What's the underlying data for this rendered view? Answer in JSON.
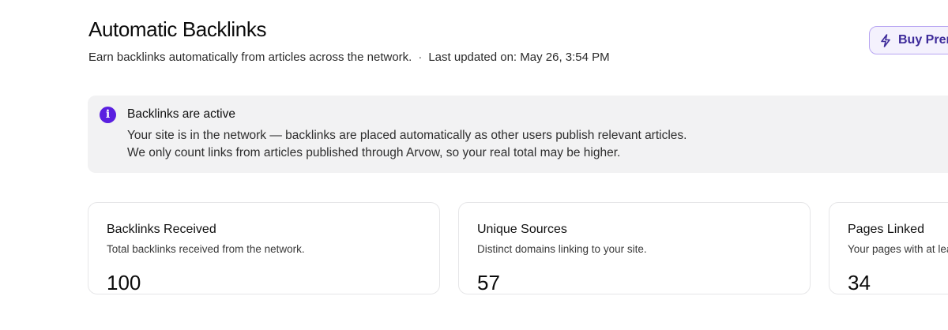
{
  "header": {
    "title": "Automatic Backlinks",
    "subtitle": "Earn backlinks automatically from articles across the network.",
    "separator": "·",
    "last_updated": "Last updated on: May 26, 3:54 PM"
  },
  "actions": {
    "buy_label": "Buy Premium",
    "buy_icon": "lightning-bolt-icon",
    "accent_color": "#3d2a9a"
  },
  "banner": {
    "icon": "info-icon",
    "icon_glyph": "i",
    "icon_color": "#5a1fe0",
    "title": "Backlinks are active",
    "line1": "Your site is in the network — backlinks are placed automatically as other users publish relevant articles.",
    "line2": "We only count links from articles published through Arvow, so your real total may be higher."
  },
  "stats": [
    {
      "title": "Backlinks Received",
      "description": "Total backlinks received from the network.",
      "value": "100"
    },
    {
      "title": "Unique Sources",
      "description": "Distinct domains linking to your site.",
      "value": "57"
    },
    {
      "title": "Pages Linked",
      "description": "Your pages with at least one backlink.",
      "value": "34"
    }
  ]
}
